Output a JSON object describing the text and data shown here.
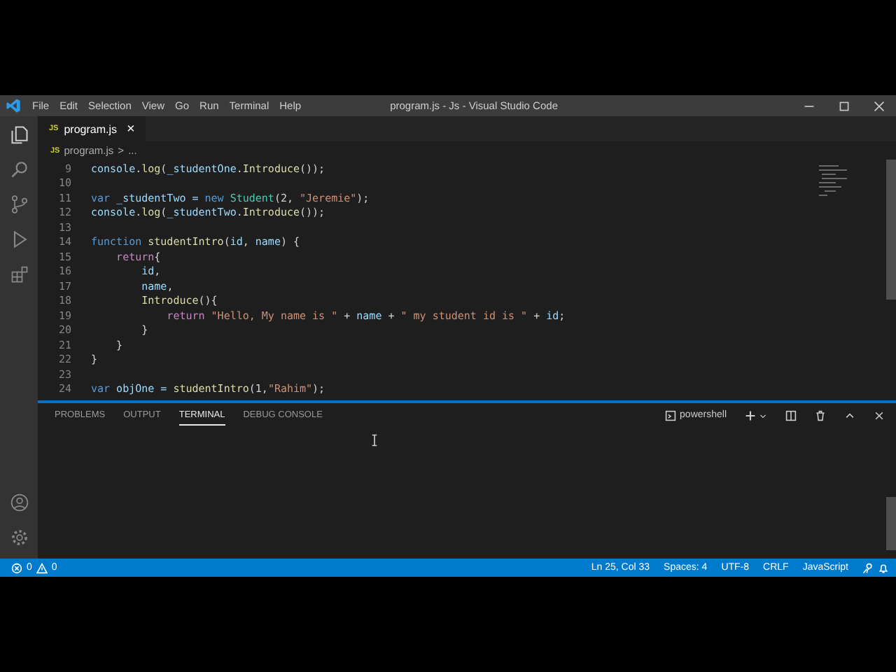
{
  "window": {
    "title": "program.js - Js - Visual Studio Code"
  },
  "menu": [
    "File",
    "Edit",
    "Selection",
    "View",
    "Go",
    "Run",
    "Terminal",
    "Help"
  ],
  "tabs": [
    {
      "label": "program.js",
      "selected": true,
      "badge": "JS",
      "close": "×"
    }
  ],
  "breadcrumbs": {
    "badge": "JS",
    "file": "program.js",
    "separator": ">",
    "rest": "..."
  },
  "code": [
    {
      "n": "9",
      "tokens": [
        {
          "t": "console",
          "kind": "var"
        },
        {
          "t": ".",
          "kind": "p"
        },
        {
          "t": "log",
          "kind": "fn"
        },
        {
          "t": "(",
          "kind": "p"
        },
        {
          "t": "_studentOne",
          "kind": "var"
        },
        {
          "t": ".",
          "kind": "p"
        },
        {
          "t": "Introduce",
          "kind": "fn"
        },
        {
          "t": "());",
          "kind": "p"
        }
      ]
    },
    {
      "n": "10"
    },
    {
      "n": "11",
      "tokens": [
        {
          "t": "var",
          "kind": "kw"
        },
        {
          "t": " _studentTwo = ",
          "kind": "var"
        },
        {
          "t": "new",
          "kind": "kw"
        },
        {
          "t": " Student",
          "kind": "cls"
        },
        {
          "t": "(2, ",
          "kind": "p"
        },
        {
          "t": "\"Jeremie\"",
          "kind": "str"
        },
        {
          "t": ");",
          "kind": "p"
        }
      ]
    },
    {
      "n": "12",
      "tokens": [
        {
          "t": "console",
          "kind": "var"
        },
        {
          "t": ".",
          "kind": "p"
        },
        {
          "t": "log",
          "kind": "fn"
        },
        {
          "t": "(",
          "kind": "p"
        },
        {
          "t": "_studentTwo",
          "kind": "var"
        },
        {
          "t": ".",
          "kind": "p"
        },
        {
          "t": "Introduce",
          "kind": "fn"
        },
        {
          "t": "());",
          "kind": "p"
        }
      ]
    },
    {
      "n": "13"
    },
    {
      "n": "14",
      "tokens": [
        {
          "t": "function",
          "kind": "kw"
        },
        {
          "t": " studentIntro",
          "kind": "fn"
        },
        {
          "t": "(",
          "kind": "p"
        },
        {
          "t": "id",
          "kind": "var"
        },
        {
          "t": ", ",
          "kind": "p"
        },
        {
          "t": "name",
          "kind": "var"
        },
        {
          "t": ") {",
          "kind": "p"
        }
      ]
    },
    {
      "n": "15",
      "tokens": [
        {
          "t": "    return",
          "kind": "ctrl"
        },
        {
          "t": "{",
          "kind": "p"
        }
      ]
    },
    {
      "n": "16",
      "tokens": [
        {
          "t": "        id",
          "kind": "var"
        },
        {
          "t": ",",
          "kind": "p"
        }
      ]
    },
    {
      "n": "17",
      "tokens": [
        {
          "t": "        name",
          "kind": "var"
        },
        {
          "t": ",",
          "kind": "p"
        }
      ]
    },
    {
      "n": "18",
      "tokens": [
        {
          "t": "        Introduce",
          "kind": "fn"
        },
        {
          "t": "(){",
          "kind": "p"
        }
      ]
    },
    {
      "n": "19",
      "tokens": [
        {
          "t": "            return",
          "kind": "ctrl"
        },
        {
          "t": " \"Hello, My name is \"",
          "kind": "str"
        },
        {
          "t": " + ",
          "kind": "p"
        },
        {
          "t": "name",
          "kind": "var"
        },
        {
          "t": " + ",
          "kind": "p"
        },
        {
          "t": "\" my student id is \"",
          "kind": "str"
        },
        {
          "t": " + ",
          "kind": "p"
        },
        {
          "t": "id",
          "kind": "var"
        },
        {
          "t": ";",
          "kind": "p"
        }
      ]
    },
    {
      "n": "20",
      "tokens": [
        {
          "t": "        }",
          "kind": "p"
        }
      ]
    },
    {
      "n": "21",
      "tokens": [
        {
          "t": "    }",
          "kind": "p"
        }
      ]
    },
    {
      "n": "22",
      "tokens": [
        {
          "t": "}",
          "kind": "p"
        }
      ]
    },
    {
      "n": "23"
    },
    {
      "n": "24",
      "tokens": [
        {
          "t": "var",
          "kind": "kw"
        },
        {
          "t": " objOne = ",
          "kind": "var"
        },
        {
          "t": "studentIntro",
          "kind": "fn"
        },
        {
          "t": "(1,",
          "kind": "p"
        },
        {
          "t": "\"Rahim\"",
          "kind": "str"
        },
        {
          "t": ");",
          "kind": "p"
        }
      ]
    }
  ],
  "panel": {
    "tabs": [
      {
        "label": "PROBLEMS",
        "selected": false
      },
      {
        "label": "OUTPUT",
        "selected": false
      },
      {
        "label": "TERMINAL",
        "selected": true
      },
      {
        "label": "DEBUG CONSOLE",
        "selected": false
      }
    ],
    "shell": "powershell"
  },
  "status_bar": {
    "errors": "0",
    "warnings": "0",
    "right": [
      "Ln 25, Col 33",
      "Spaces: 4",
      "UTF-8",
      "CRLF",
      "JavaScript"
    ]
  }
}
